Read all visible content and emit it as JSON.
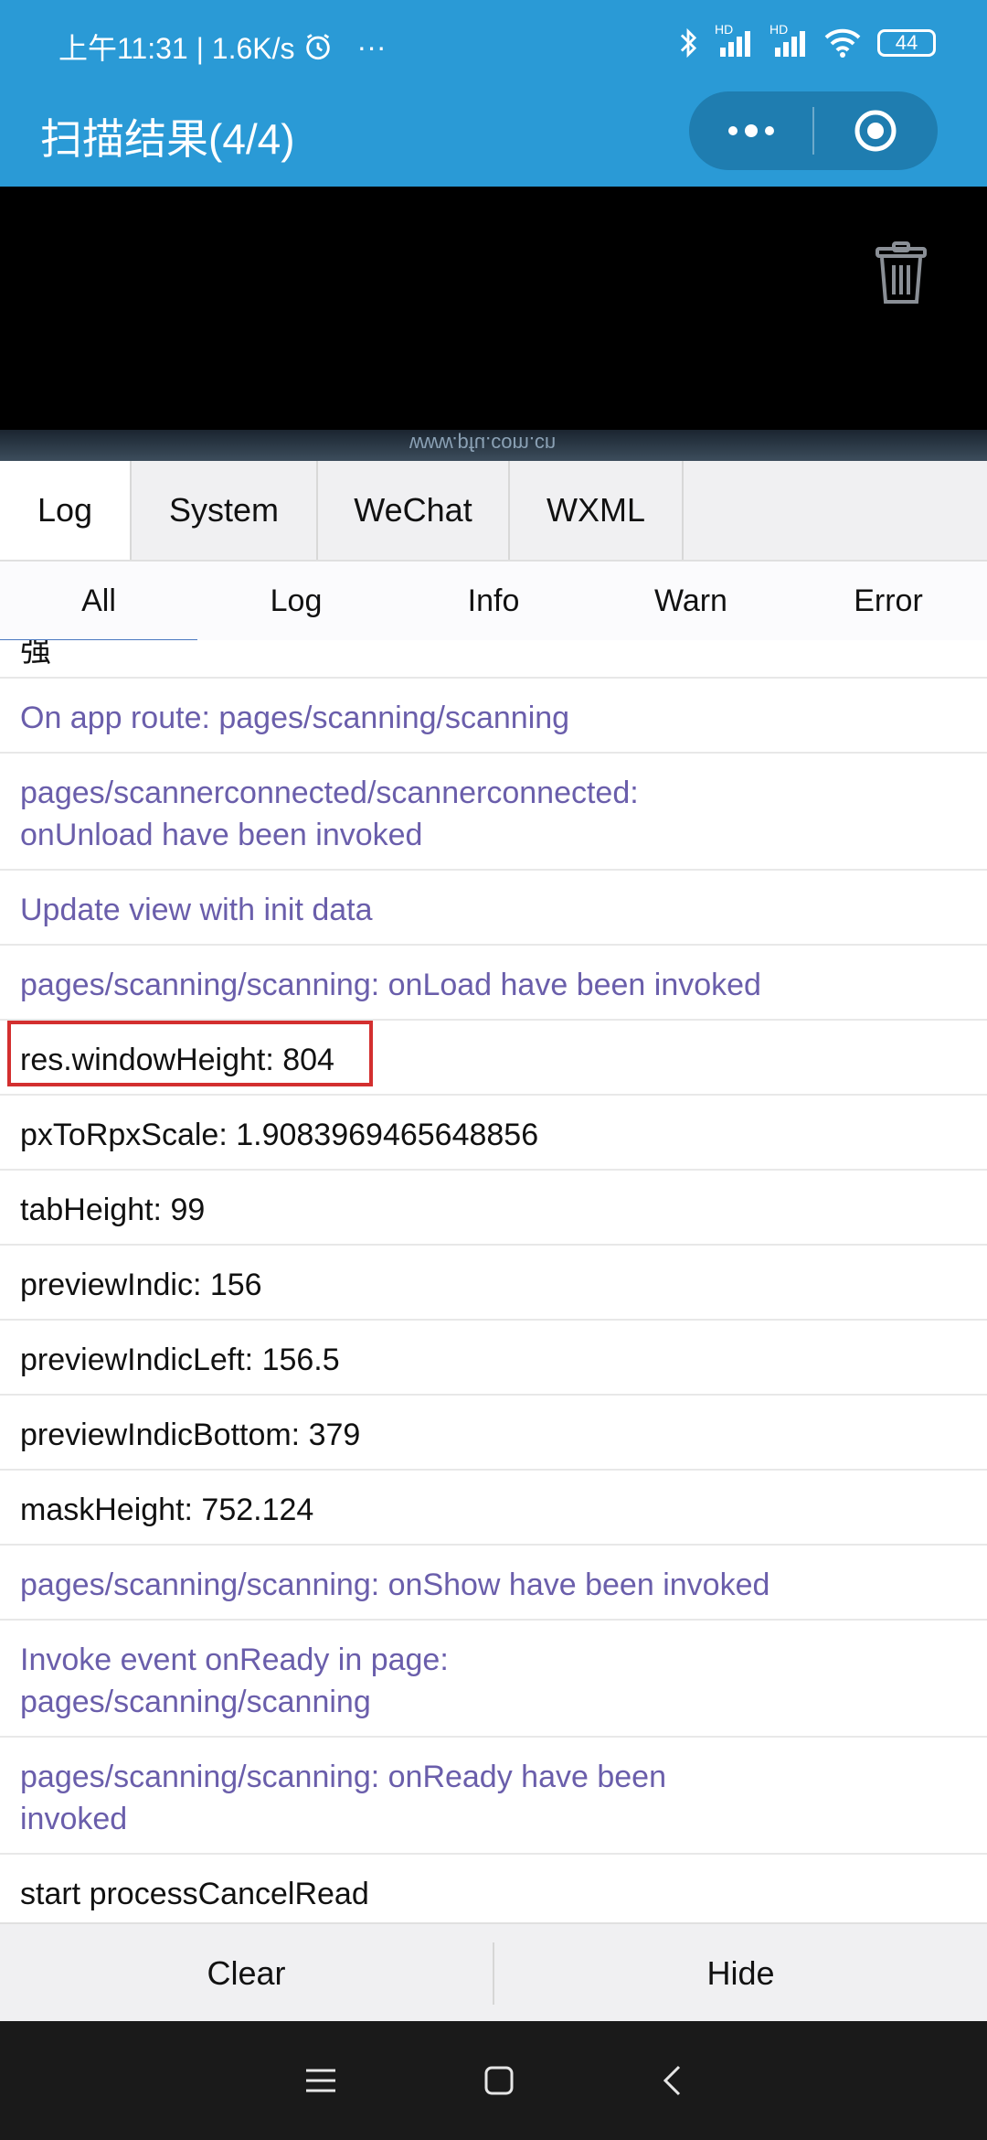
{
  "status_bar": {
    "left_text": "上午11:31 | 1.6K/s",
    "more": "···",
    "battery": "44",
    "network_badge_1": "HD",
    "network_badge_2": "HD"
  },
  "nav": {
    "title": "扫描结果(4/4)"
  },
  "preview": {
    "watermark": "www.pfu.com.cn"
  },
  "tabs": [
    {
      "label": "Log",
      "active": true
    },
    {
      "label": "System"
    },
    {
      "label": "WeChat"
    },
    {
      "label": "WXML"
    }
  ],
  "filters": [
    {
      "label": "All",
      "active": true
    },
    {
      "label": "Log"
    },
    {
      "label": "Info"
    },
    {
      "label": "Warn"
    },
    {
      "label": "Error"
    }
  ],
  "logs": {
    "partial": "强",
    "rows": [
      {
        "text": "On app route: pages/scanning/scanning",
        "kind": "system"
      },
      {
        "text": "pages/scannerconnected/scannerconnected: onUnload have been invoked",
        "kind": "system"
      },
      {
        "text": "Update view with init data",
        "kind": "system"
      },
      {
        "text": "pages/scanning/scanning: onLoad have been invoked",
        "kind": "system"
      },
      {
        "text": "res.windowHeight: 804",
        "kind": "log"
      },
      {
        "text": "pxToRpxScale: 1.9083969465648856",
        "kind": "log"
      },
      {
        "text": "tabHeight: 99",
        "kind": "log"
      },
      {
        "text": "previewIndic: 156",
        "kind": "log"
      },
      {
        "text": "previewIndicLeft: 156.5",
        "kind": "log"
      },
      {
        "text": "previewIndicBottom: 379",
        "kind": "log"
      },
      {
        "text": "maskHeight: 752.124",
        "kind": "log"
      },
      {
        "text": "pages/scanning/scanning: onShow have been invoked",
        "kind": "system"
      },
      {
        "text": "Invoke event onReady in page: pages/scanning/scanning",
        "kind": "system"
      },
      {
        "text": "pages/scanning/scanning: onReady have been invoked",
        "kind": "system"
      },
      {
        "text": "start processCancelRead",
        "kind": "log"
      }
    ]
  },
  "actions": {
    "clear": "Clear",
    "hide": "Hide"
  },
  "colors": {
    "header": "#2a9ad6",
    "system_log_text": "#6a5eab",
    "highlight_border": "#d32f2f"
  }
}
